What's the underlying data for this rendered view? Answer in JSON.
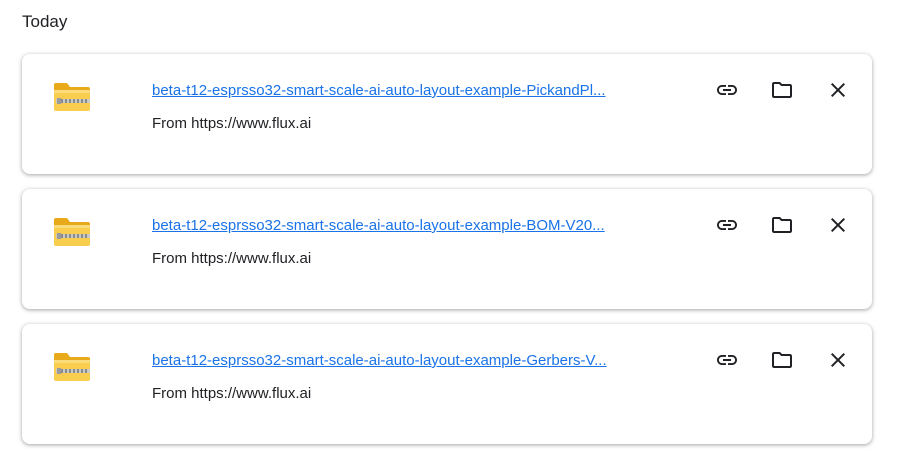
{
  "section": {
    "title": "Today"
  },
  "downloads": [
    {
      "filename": "beta-t12-esprsso32-smart-scale-ai-auto-layout-example-PickandPl...",
      "source": "From https://www.flux.ai"
    },
    {
      "filename": "beta-t12-esprsso32-smart-scale-ai-auto-layout-example-BOM-V20...",
      "source": "From https://www.flux.ai"
    },
    {
      "filename": "beta-t12-esprsso32-smart-scale-ai-auto-layout-example-Gerbers-V...",
      "source": "From https://www.flux.ai"
    }
  ],
  "icons": {
    "file": "zip-folder-icon",
    "copy": "link-icon",
    "folder": "folder-icon",
    "remove": "close-icon"
  },
  "colors": {
    "link": "#1a73e8",
    "text": "#202124",
    "icon": "#202124",
    "folder_yellow": "#f8c843"
  }
}
